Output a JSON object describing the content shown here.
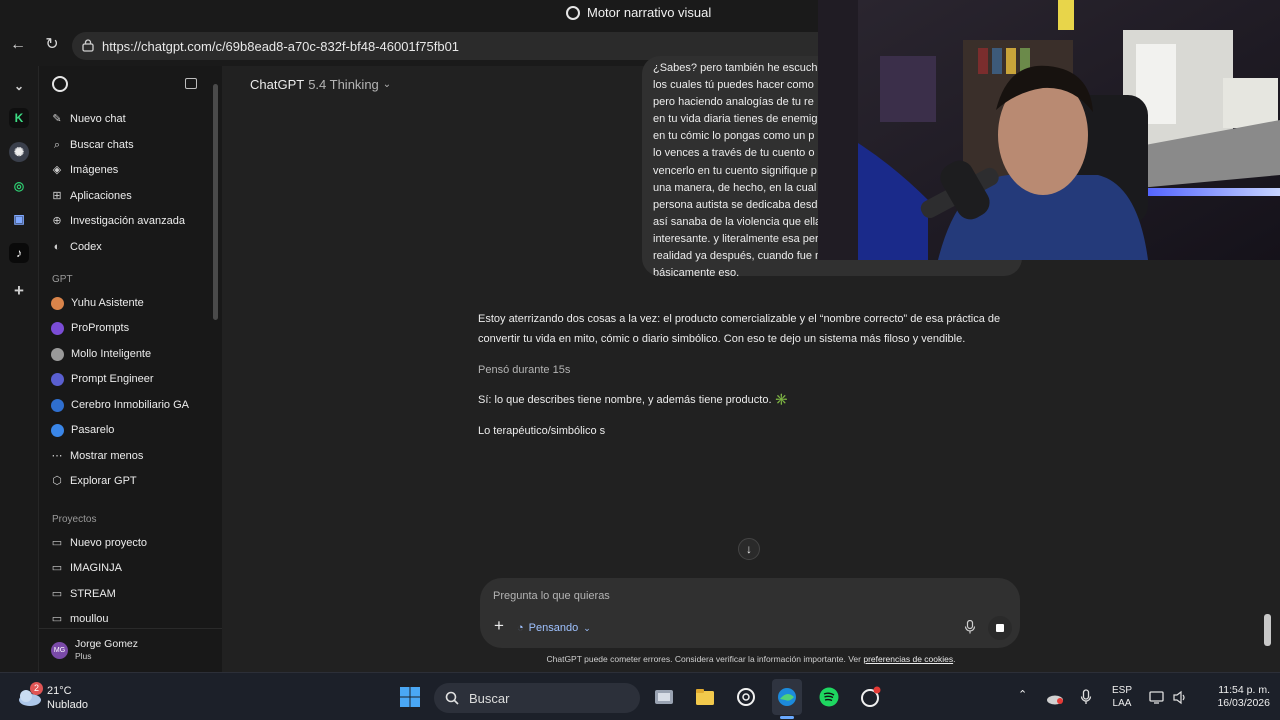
{
  "window": {
    "title": "Motor narrativo visual"
  },
  "browser": {
    "url": "https://chatgpt.com/c/69b8ead8-a70c-832f-bf48-46001f75fb01"
  },
  "sidebar": {
    "top_items": [
      {
        "label": "Nuevo chat",
        "icon": "new-chat-icon"
      },
      {
        "label": "Buscar chats",
        "icon": "search-icon"
      },
      {
        "label": "Imágenes",
        "icon": "images-icon"
      },
      {
        "label": "Aplicaciones",
        "icon": "apps-icon"
      },
      {
        "label": "Investigación avanzada",
        "icon": "research-icon"
      },
      {
        "label": "Codex",
        "icon": "codex-icon"
      }
    ],
    "gpt_section": "GPT",
    "gpts": [
      {
        "label": "Yuhu Asistente",
        "color": "#d9844a"
      },
      {
        "label": "ProPrompts",
        "color": "#7b4dd6"
      },
      {
        "label": "Mollo Inteligente",
        "color": "#9a9a9a"
      },
      {
        "label": "Prompt Engineer",
        "color": "#5a5fd0"
      },
      {
        "label": "Cerebro Inmobiliario GA",
        "color": "#2f6fcf"
      },
      {
        "label": "Pasarelo",
        "color": "#3a86e8"
      }
    ],
    "show_less": "Mostrar menos",
    "explore": "Explorar GPT",
    "projects_section": "Proyectos",
    "projects": [
      {
        "label": "Nuevo proyecto"
      },
      {
        "label": "IMAGINJA"
      },
      {
        "label": "STREAM"
      },
      {
        "label": "moullou"
      }
    ],
    "user": {
      "name": "Jorge Gomez",
      "plan": "Plus",
      "initials": "MG"
    }
  },
  "header": {
    "model": "ChatGPT",
    "version": "5.4 Thinking"
  },
  "user_message_lines": [
    "¿Sabes? pero también he escucha",
    "los cuales tú puedes hacer como",
    "pero haciendo analogías de tu re",
    "en tu vida diaria tienes de enemig",
    "en tu cómic lo pongas como un p",
    "lo vences a través de tu cuento o",
    "vencerlo en tu cuento signifique p",
    "una manera, de hecho, en la cual",
    "persona autista se dedicaba desd",
    "así sanaba de la violencia que ella",
    "interesante. y literalmente esa per",
    "realidad ya después, cuando fue m",
    "básicamente eso."
  ],
  "assistant": {
    "intro": "Estoy aterrizando dos cosas a la vez: el producto comercializable y el “nombre correcto” de esa práctica de convertir tu vida en mito, cómic o diario simbólico. Con eso te dejo un sistema más filoso y vendible.",
    "thought_for": "Pensó durante 15s",
    "answer": "Sí: lo que describes tiene nombre, y además tiene producto. ✳️",
    "partial": "Lo terapéutico/simbólico s"
  },
  "composer": {
    "placeholder": "Pregunta lo que quieras",
    "mode": "Pensando"
  },
  "disclaimer": {
    "text": "ChatGPT puede cometer errores. Considera verificar la información importante. Ver ",
    "link": "preferencias de cookies",
    "end": "."
  },
  "taskbar": {
    "weather": {
      "temp": "21°C",
      "desc": "Nublado",
      "badge": "2"
    },
    "search": "Buscar",
    "lang": "ESP",
    "layout": "LAA",
    "time": "11:54 p. m.",
    "date": "16/03/2026"
  }
}
